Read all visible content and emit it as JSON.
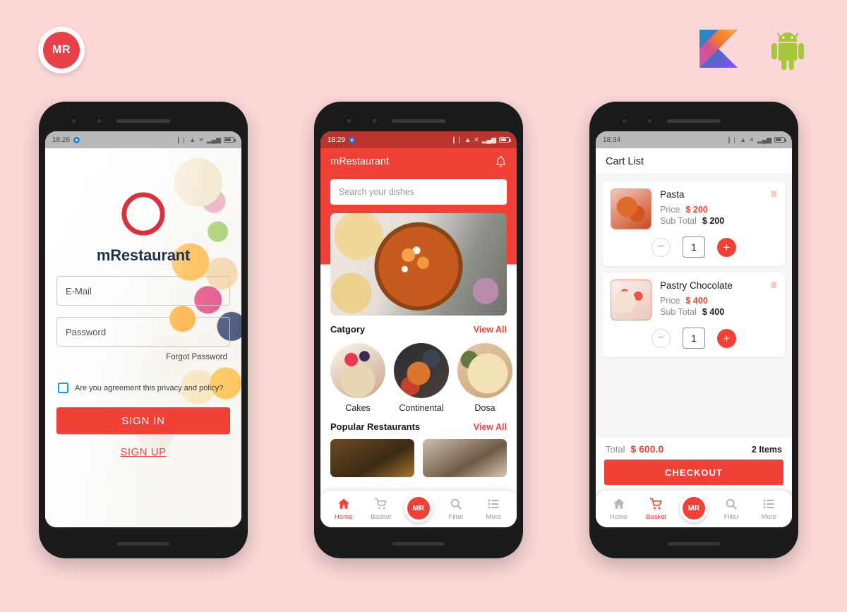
{
  "brand": {
    "badge_initials": "MR",
    "accent_color": "#ef4136",
    "logos": [
      "kotlin-logo",
      "android-logo"
    ]
  },
  "phone1": {
    "status": {
      "time": "18:26",
      "icons": [
        "vibrate-icon",
        "wifi-icon",
        "signal-off-icon",
        "cellular-icon",
        "battery-icon"
      ]
    },
    "login": {
      "logo_title": "mRestaurant",
      "email_placeholder": "E-Mail",
      "password_placeholder": "Password",
      "forgot_label": "Forgot Password",
      "agree_label": "Are you agreement this privacy and policy?",
      "signin_label": "SIGN IN",
      "signup_label": "SIGN UP"
    }
  },
  "phone2": {
    "status": {
      "time": "18:29",
      "icons": [
        "vibrate-icon",
        "wifi-icon",
        "signal-off-icon",
        "cellular-icon",
        "battery-icon"
      ]
    },
    "appbar": {
      "title": "mRestaurant",
      "bell": "notification-bell-icon"
    },
    "search": {
      "placeholder": "Search your dishes"
    },
    "category": {
      "title": "Catgory",
      "view_all": "View All",
      "items": [
        {
          "label": "Cakes"
        },
        {
          "label": "Continental"
        },
        {
          "label": "Dosa"
        }
      ]
    },
    "popular": {
      "title": "Popular Restaurants",
      "view_all": "View All"
    },
    "nav": {
      "items": [
        {
          "label": "Home",
          "icon": "home-icon",
          "active": true
        },
        {
          "label": "Basket",
          "icon": "cart-icon",
          "active": false
        },
        {
          "label": "Filter",
          "icon": "search-icon",
          "active": false
        },
        {
          "label": "More",
          "icon": "list-icon",
          "active": false
        }
      ],
      "fab_label": "MR"
    }
  },
  "phone3": {
    "status": {
      "time": "18:34",
      "icons": [
        "vibrate-icon",
        "wifi-icon",
        "signal-off-icon",
        "cellular-icon",
        "battery-icon"
      ]
    },
    "header": {
      "title": "Cart List"
    },
    "items": [
      {
        "name": "Pasta",
        "price_label": "Price",
        "price_value": "$ 200",
        "subtotal_label": "Sub Total",
        "subtotal_value": "$ 200",
        "qty": "1"
      },
      {
        "name": "Pastry Chocolate",
        "price_label": "Price",
        "price_value": "$ 400",
        "subtotal_label": "Sub Total",
        "subtotal_value": "$ 400",
        "qty": "1"
      }
    ],
    "footer": {
      "total_label": "Total",
      "total_value": "$ 600.0",
      "items_count": "2 Items",
      "checkout_label": "CHECKOUT"
    },
    "nav": {
      "items": [
        {
          "label": "Home",
          "icon": "home-icon",
          "active": false
        },
        {
          "label": "Basket",
          "icon": "cart-icon",
          "active": true
        },
        {
          "label": "Filter",
          "icon": "search-icon",
          "active": false
        },
        {
          "label": "More",
          "icon": "list-icon",
          "active": false
        }
      ],
      "fab_label": "MR"
    }
  }
}
